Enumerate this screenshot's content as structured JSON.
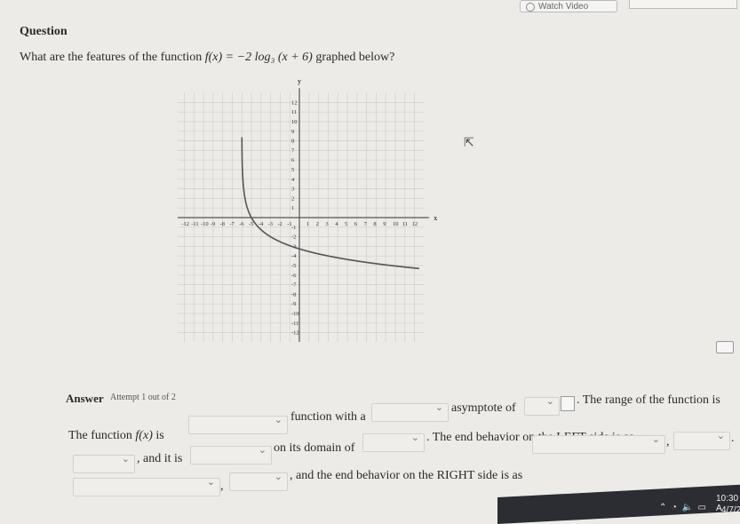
{
  "header": {
    "watch_video_label": "Watch Video"
  },
  "question": {
    "title": "Question",
    "text_before": "What are the features of the function ",
    "function": "f(x) = −2 log₃ (x + 6)",
    "text_after": " graphed below?"
  },
  "graph": {
    "function": "y = -2*log3(x+6)",
    "x_range": [
      -12,
      12
    ],
    "y_range": [
      -12,
      12
    ],
    "x_label": "x",
    "y_label": "y",
    "grid": true,
    "curve_color": "#555555",
    "x_ticks": [
      "-12",
      "-11",
      "-10",
      "-9",
      "-8",
      "-7",
      "-6",
      "-5",
      "-4",
      "-3",
      "-2",
      "-1",
      "1",
      "2",
      "3",
      "4",
      "5",
      "6",
      "7",
      "8",
      "9",
      "10",
      "11",
      "12"
    ],
    "y_ticks": [
      "12",
      "11",
      "10",
      "9",
      "8",
      "7",
      "6",
      "5",
      "4",
      "3",
      "2",
      "1",
      "-1",
      "-2",
      "-3",
      "-4",
      "-5",
      "-6",
      "-7",
      "-8",
      "-9",
      "-10",
      "-11",
      "-12"
    ]
  },
  "answer": {
    "label": "Answer",
    "attempt": "Attempt 1 out of 2",
    "t1": "The function ",
    "fx": "f(x)",
    "t2": " is",
    "t3": "function with a",
    "t4": "asymptote of",
    "t5": ". The range of the function is",
    "t6": ". The end behavior on the LEFT side is as",
    "t7": ", and it is",
    "t8": "on its domain of",
    "t9": ",",
    "t10": ".",
    "t11": ",",
    "t12": ", and the end behavior on the RIGHT side is as"
  },
  "taskbar": {
    "time": "10:30 A",
    "date": "4/7/20"
  }
}
